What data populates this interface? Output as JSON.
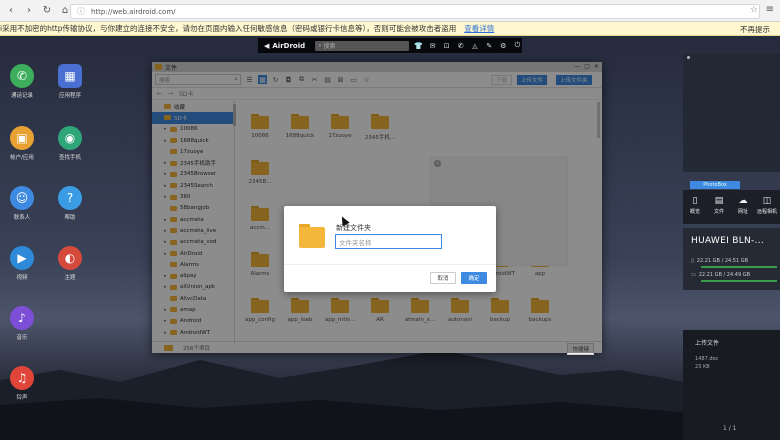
{
  "browser": {
    "url": "http://web.airdroid.com/",
    "warning": "i采用不加密的http传输协议，与你建立的连接不安全，请勿在页面内输入任何敏感信息（密码或银行卡信息等），否则可能会被攻击者盗用",
    "warning_link": "查看详情",
    "dismiss": "不再提示"
  },
  "toolbar": {
    "brand": "AirDroid",
    "search_placeholder": "搜索"
  },
  "desktop_icons": [
    {
      "label": "通话记录",
      "color": "#3cae5c",
      "glyph": "✆"
    },
    {
      "label": "应用程序",
      "color": "#4a6fd2",
      "glyph": "▦"
    },
    {
      "label": "帐户/应用",
      "color": "#e8a233",
      "glyph": "▣"
    },
    {
      "label": "查找手机",
      "color": "#2fa57a",
      "glyph": "◉"
    },
    {
      "label": "联系人",
      "color": "#3d8ae0",
      "glyph": "☺"
    },
    {
      "label": "帮助",
      "color": "#3b9ce5",
      "glyph": "?"
    },
    {
      "label": "视频",
      "color": "#2e8ad8",
      "glyph": "▶"
    },
    {
      "label": "主题",
      "color": "#d54a3a",
      "glyph": "◐"
    },
    {
      "label": "音乐",
      "color": "#7c4fd6",
      "glyph": "♪"
    },
    {
      "label": "铃声",
      "color": "#e0453a",
      "glyph": "♫"
    }
  ],
  "file_window": {
    "title": "文件",
    "search_placeholder": "搜索",
    "upload_file": "上传文件",
    "upload_folder": "上传文件夹",
    "disabled_btn": "下载",
    "path_back": "←",
    "path_forward": "→",
    "path": "SD卡",
    "tree": [
      {
        "label": "收藏",
        "arrow": "",
        "selected": false
      },
      {
        "label": "SD卡",
        "arrow": "▾",
        "selected": true
      },
      {
        "label": "10086",
        "arrow": "▸",
        "selected": false
      },
      {
        "label": "1688quick",
        "arrow": "▸",
        "selected": false
      },
      {
        "label": "17zuoye",
        "arrow": "",
        "selected": false
      },
      {
        "label": "2345手机助手",
        "arrow": "▸",
        "selected": false
      },
      {
        "label": "2345Browser",
        "arrow": "▸",
        "selected": false
      },
      {
        "label": "2345Search",
        "arrow": "▸",
        "selected": false
      },
      {
        "label": "360",
        "arrow": "▸",
        "selected": false
      },
      {
        "label": "58bangjob",
        "arrow": "",
        "selected": false
      },
      {
        "label": "accmeta",
        "arrow": "▸",
        "selected": false
      },
      {
        "label": "accmeta_live",
        "arrow": "▸",
        "selected": false
      },
      {
        "label": "accmeta_vod",
        "arrow": "▸",
        "selected": false
      },
      {
        "label": "AirDroid",
        "arrow": "▸",
        "selected": false
      },
      {
        "label": "Alarms",
        "arrow": "",
        "selected": false
      },
      {
        "label": "alipay",
        "arrow": "▸",
        "selected": false
      },
      {
        "label": "aliUnion_apk",
        "arrow": "▸",
        "selected": false
      },
      {
        "label": "AlivcData",
        "arrow": "",
        "selected": false
      },
      {
        "label": "amap",
        "arrow": "▸",
        "selected": false
      },
      {
        "label": "Android",
        "arrow": "▸",
        "selected": false
      },
      {
        "label": "AndroidWT",
        "arrow": "▸",
        "selected": false
      }
    ],
    "files_row1": [
      "10086",
      "1688quick",
      "17zuoye",
      "2345手机..."
    ],
    "files_row2": [
      "2345B...",
      "",
      "",
      ""
    ],
    "files_row3": [
      "accm...",
      "",
      "",
      ""
    ],
    "files_row4": [
      "Alarms",
      "alipay",
      "aliUnion_...",
      "AlivcData",
      "amap",
      "Android",
      "AndroidWT",
      "app"
    ],
    "files_row5": [
      "app_config",
      "app_loab",
      "app_mtis...",
      "AR",
      "atmain_x...",
      "autonavi",
      "backup",
      "backups"
    ],
    "status": "256个项目",
    "fast_btn": "快捷键"
  },
  "modal": {
    "title": "新建文件夹",
    "placeholder": "文件夹名称",
    "cancel": "取消",
    "ok": "确定"
  },
  "right_panel": {
    "tab": "PhotoBox",
    "icons": [
      {
        "label": "概览",
        "glyph": "▯"
      },
      {
        "label": "文件",
        "glyph": "▤"
      },
      {
        "label": "网址",
        "glyph": "☁"
      },
      {
        "label": "远程相机",
        "glyph": "◫"
      }
    ],
    "device_name": "HUAWEI BLN-...",
    "storage1": "22.21 GB / 24.51 GB",
    "storage2": "22.21 GB / 24.49 GB",
    "upload_title": "上传文件",
    "upload_file": "1487.doc",
    "upload_size": "23 KB",
    "page": "1 / 1"
  }
}
